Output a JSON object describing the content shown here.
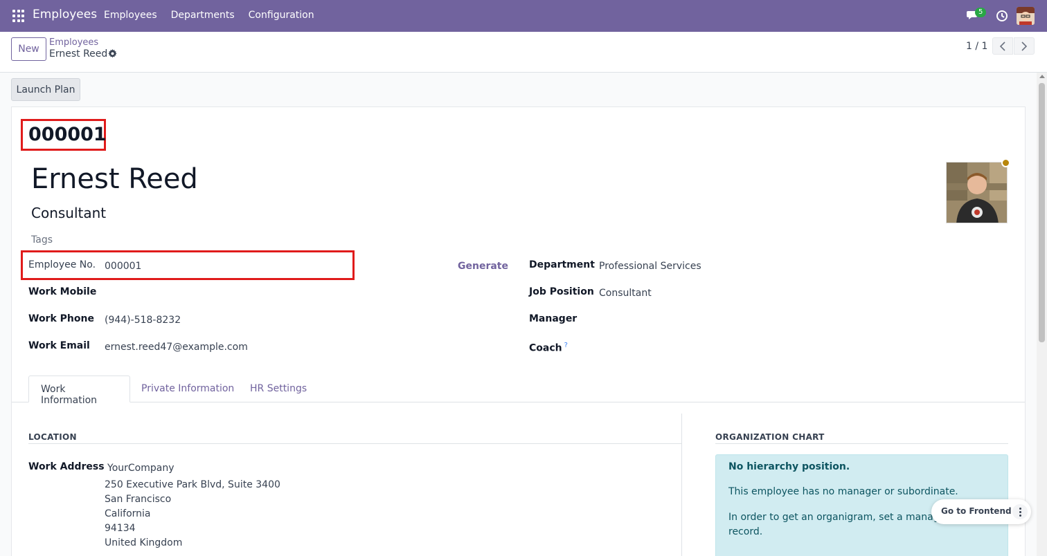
{
  "navbar": {
    "app_name": "Employees",
    "menu": [
      "Employees",
      "Departments",
      "Configuration"
    ],
    "chat_badge": "5",
    "color": "#71639e"
  },
  "control": {
    "new_label": "New",
    "breadcrumb_parent": "Employees",
    "breadcrumb_current": "Ernest Reed",
    "pager": "1 / 1"
  },
  "actions": {
    "launch_plan": "Launch Plan"
  },
  "employee": {
    "number_heading": "000001",
    "name": "Ernest Reed",
    "job_title": "Consultant",
    "tags_placeholder": "Tags",
    "status_color": "#b8860b"
  },
  "fields_left": {
    "employee_no_label": "Employee No.",
    "employee_no_value": "000001",
    "generate_label": "Generate",
    "work_mobile_label": "Work Mobile",
    "work_mobile_value": "",
    "work_phone_label": "Work Phone",
    "work_phone_value": "(944)-518-8232",
    "work_email_label": "Work Email",
    "work_email_value": "ernest.reed47@example.com"
  },
  "fields_right": {
    "department_label": "Department",
    "department_value": "Professional Services",
    "job_position_label": "Job Position",
    "job_position_value": "Consultant",
    "manager_label": "Manager",
    "manager_value": "",
    "coach_label": "Coach",
    "coach_help": "?",
    "coach_value": ""
  },
  "tabs": [
    "Work Information",
    "Private Information",
    "HR Settings"
  ],
  "location": {
    "heading": "LOCATION",
    "work_address_label": "Work Address",
    "address_lines": [
      "YourCompany",
      "250 Executive Park Blvd, Suite 3400",
      "San Francisco",
      "California",
      "94134",
      "United Kingdom"
    ]
  },
  "org_chart": {
    "heading": "ORGANIZATION CHART",
    "title": "No hierarchy position.",
    "text1": "This employee has no manager or subordinate.",
    "text2_line1": "In order to get an organigram, set a manager a",
    "text2_line2": "record."
  },
  "frontend": {
    "label": "Go to Frontend"
  }
}
